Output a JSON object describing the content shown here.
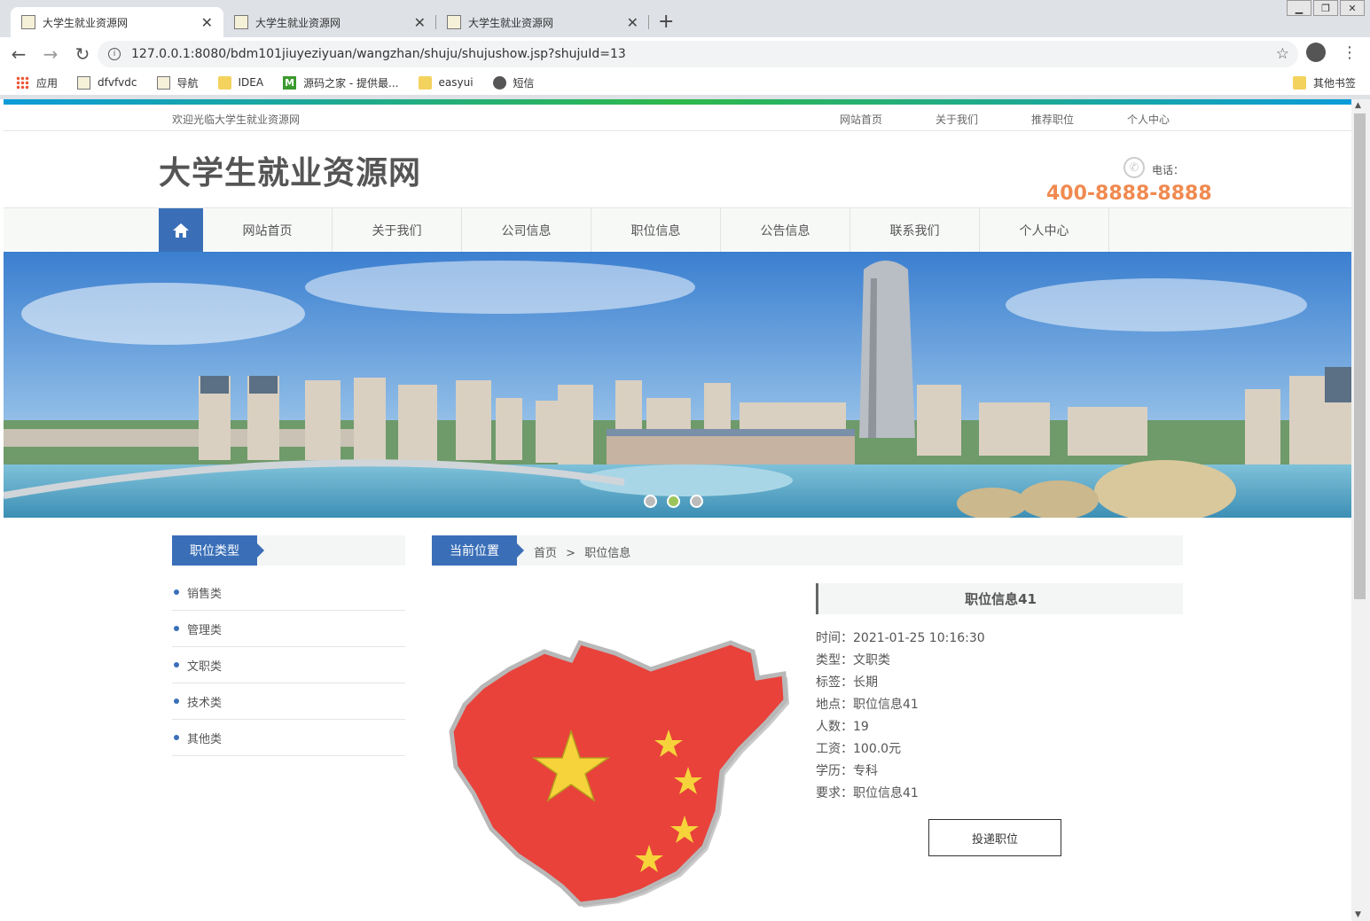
{
  "browser": {
    "tabs": [
      {
        "title": "大学生就业资源网"
      },
      {
        "title": "大学生就业资源网"
      },
      {
        "title": "大学生就业资源网"
      }
    ],
    "url": "127.0.0.1:8080/bdm101jiuyeziyuan/wangzhan/shuju/shujushow.jsp?shujuId=13",
    "bookmarks": [
      {
        "label": "应用",
        "icon": "apps-grid-icon"
      },
      {
        "label": "dfvfvdc",
        "icon": "page-icon"
      },
      {
        "label": "导航",
        "icon": "page-icon"
      },
      {
        "label": "IDEA",
        "icon": "folder-icon"
      },
      {
        "label": "源码之家 - 提供最...",
        "icon": "m-logo-icon"
      },
      {
        "label": "easyui",
        "icon": "folder-icon"
      },
      {
        "label": "短信",
        "icon": "globe-icon"
      }
    ],
    "other_bookmarks": "其他书签"
  },
  "site": {
    "welcome": "欢迎光临大学生就业资源网",
    "top_links": [
      "网站首页",
      "关于我们",
      "推荐职位",
      "个人中心"
    ],
    "logo": "大学生就业资源网",
    "phone_label": "电话：",
    "phone_number": "400-8888-8888",
    "nav": [
      "网站首页",
      "关于我们",
      "公司信息",
      "职位信息",
      "公告信息",
      "联系我们",
      "个人中心"
    ],
    "banner_slides": 3,
    "banner_active": 2
  },
  "sidebar": {
    "title": "职位类型",
    "categories": [
      "销售类",
      "管理类",
      "文职类",
      "技术类",
      "其他类"
    ]
  },
  "content": {
    "location_label": "当前位置",
    "crumb_home": "首页",
    "crumb_sep": ">",
    "crumb_current": "职位信息",
    "job": {
      "title": "职位信息41",
      "lines": [
        "时间：2021-01-25 10:16:30",
        "类型：文职类",
        "标签：长期",
        "地点：职位信息41",
        "人数：19",
        "工资：100.0元",
        "学历：专科",
        "要求：职位信息41"
      ],
      "apply_button": "投递职位"
    }
  },
  "colors": {
    "accent_blue": "#3a6fb8",
    "phone_orange": "#f08a50",
    "top_bar_gradient": "#0d9bd8"
  }
}
